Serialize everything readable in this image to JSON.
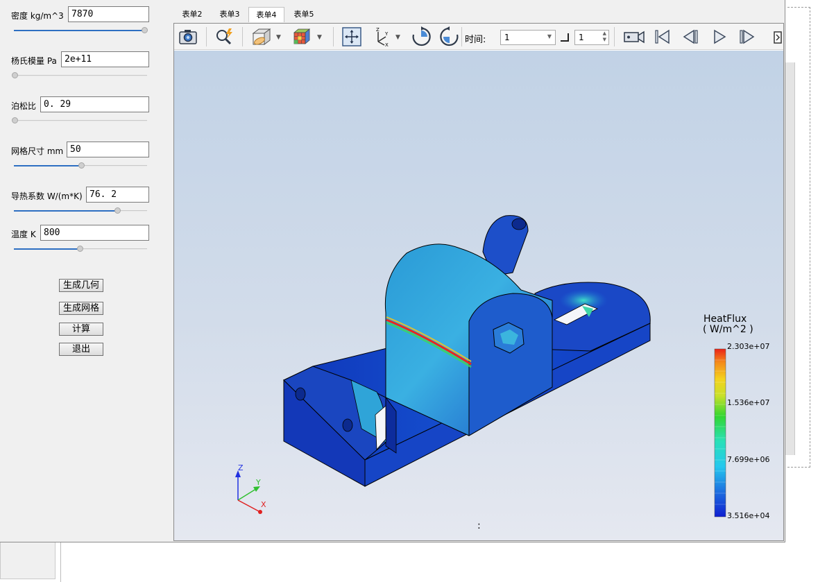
{
  "params": [
    {
      "label": "密度 kg/m^3",
      "value": "7870",
      "slider": 0.96
    },
    {
      "label": "杨氏模量 Pa",
      "value": "2e+11",
      "slider": 0.0
    },
    {
      "label": "泊松比",
      "value": "0. 29",
      "slider": 0.0
    },
    {
      "label": "网格尺寸 mm",
      "value": "50",
      "slider": 0.5
    },
    {
      "label": "导热系数 W/(m*K)",
      "value": "76. 2",
      "slider": 0.78
    },
    {
      "label": "温度 K",
      "value": "800",
      "slider": 0.5
    }
  ],
  "buttons": {
    "gen_geometry": "生成几何",
    "gen_mesh": "生成网格",
    "compute": "计算",
    "exit": "退出"
  },
  "tabs": [
    "表单2",
    "表单3",
    "表单4",
    "表单5"
  ],
  "active_tab": "表单4",
  "toolbar": {
    "time_label": "时间:",
    "time_value": "1",
    "step_value": "1"
  },
  "legend": {
    "title": "HeatFlux",
    "unit": "( W/m^2 )",
    "max": "2.303e+07",
    "v2": "1.536e+07",
    "v3": "7.699e+06",
    "min": "3.516e+04"
  },
  "axes": {
    "x": "X",
    "y": "Y",
    "z": "Z"
  },
  "status_text": ":",
  "colors": {
    "accent": "#2d6fc2",
    "mesh_blue": "#1a3fc4",
    "hot": "#e8281c"
  }
}
